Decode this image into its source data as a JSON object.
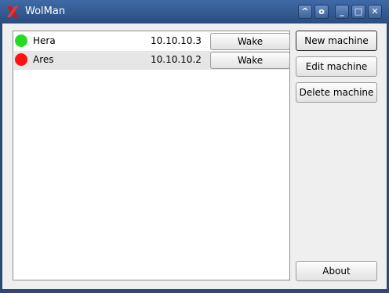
{
  "window": {
    "title": "WolMan"
  },
  "title_buttons": {
    "help": "^",
    "settings": "o",
    "minimize": "_",
    "maximize": "□",
    "close": "✕"
  },
  "machines": [
    {
      "name": "Hera",
      "ip": "10.10.10.3",
      "status": "online",
      "status_color": "#22dd22",
      "action_label": "Wake"
    },
    {
      "name": "Ares",
      "ip": "10.10.10.2",
      "status": "offline",
      "status_color": "#ff1111",
      "action_label": "Wake"
    }
  ],
  "actions": {
    "new_machine": "New machine",
    "edit_machine": "Edit machine",
    "delete_machine": "Delete machine",
    "about": "About"
  },
  "colors": {
    "titlebar": "#2f5489",
    "online": "#22dd22",
    "offline": "#ff1111"
  }
}
